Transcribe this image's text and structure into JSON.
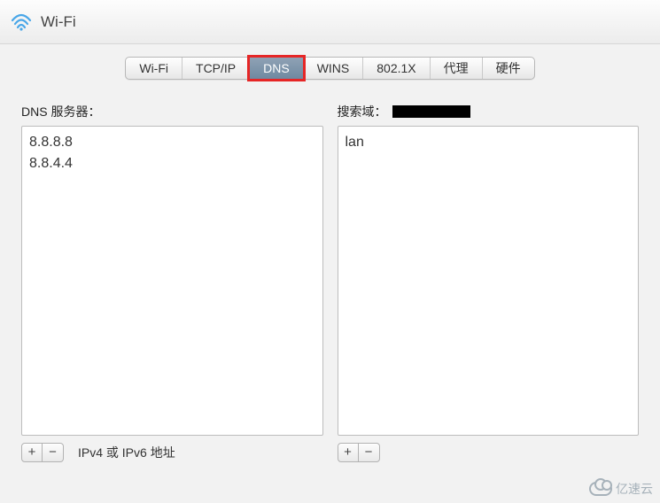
{
  "header": {
    "title": "Wi-Fi"
  },
  "tabs": [
    {
      "label": "Wi-Fi"
    },
    {
      "label": "TCP/IP"
    },
    {
      "label": "DNS"
    },
    {
      "label": "WINS"
    },
    {
      "label": "802.1X"
    },
    {
      "label": "代理"
    },
    {
      "label": "硬件"
    }
  ],
  "selected_tab": "DNS",
  "dns": {
    "label": "DNS 服务器：",
    "servers": [
      "8.8.8.8",
      "8.8.4.4"
    ],
    "hint": "IPv4 或 IPv6 地址",
    "add": "+",
    "remove": "−"
  },
  "search_domains": {
    "label": "搜索域：",
    "domains": [
      "lan"
    ],
    "add": "+",
    "remove": "−"
  },
  "watermark": "亿速云"
}
